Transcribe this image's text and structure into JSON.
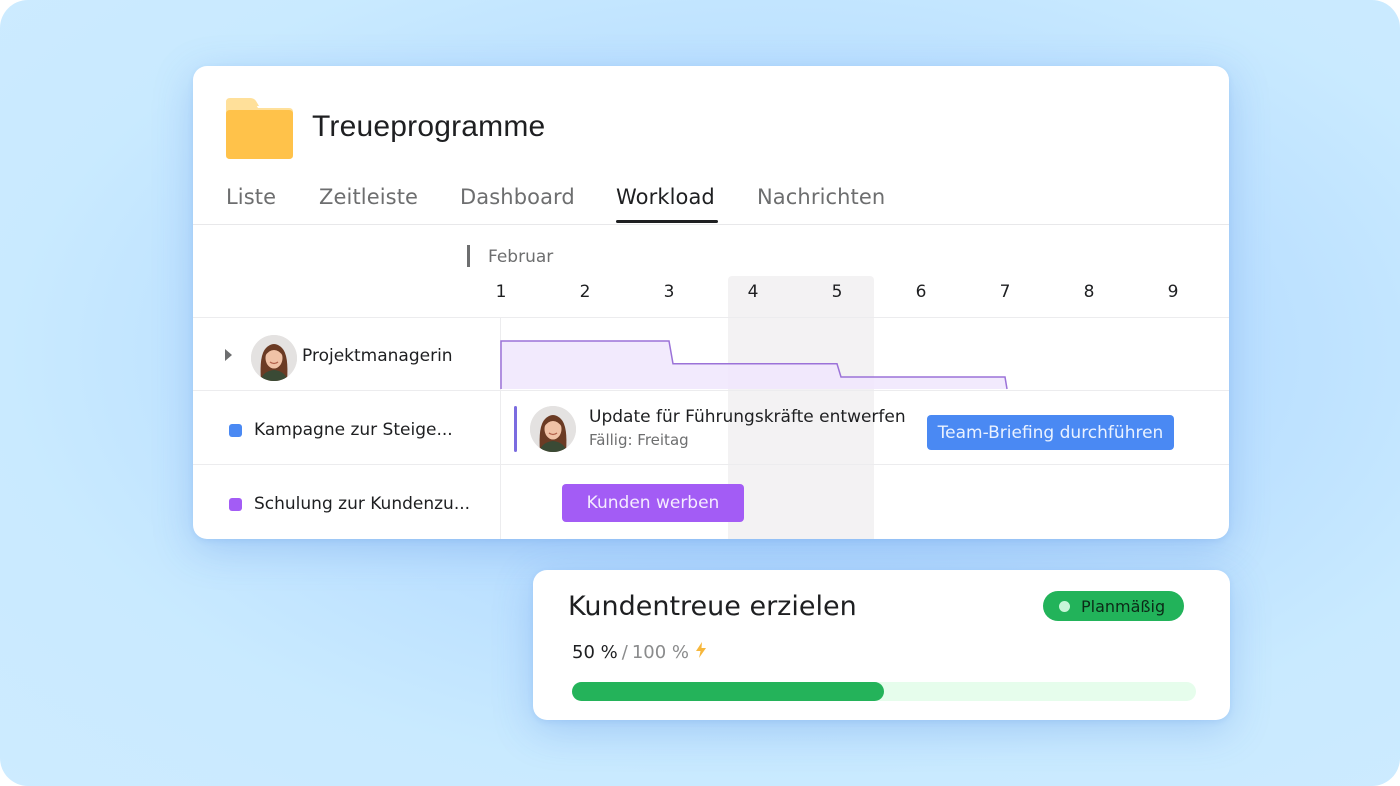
{
  "project": {
    "title": "Treueprogramme",
    "icon": "folder-icon",
    "folder_color": "#FFC24A"
  },
  "tabs": [
    {
      "label": "Liste",
      "active": false
    },
    {
      "label": "Zeitleiste",
      "active": false
    },
    {
      "label": "Dashboard",
      "active": false
    },
    {
      "label": "Workload",
      "active": true
    },
    {
      "label": "Nachrichten",
      "active": false
    }
  ],
  "timeline": {
    "month": "Februar",
    "days": [
      "1",
      "2",
      "3",
      "4",
      "5",
      "6",
      "7",
      "8",
      "9"
    ],
    "weekend_days": [
      "4",
      "5"
    ]
  },
  "rows": {
    "person": {
      "name": "Projektmanagerin",
      "expand_icon": "caret-right-icon",
      "workload_levels": [
        {
          "from_day": 1,
          "to_day": 3,
          "level": 0.8
        },
        {
          "from_day": 3,
          "to_day": 5,
          "level": 0.42
        },
        {
          "from_day": 5,
          "to_day": 7,
          "level": 0.2
        }
      ],
      "workload_color": "#9b72d8",
      "workload_fill": "#f0e6fd"
    },
    "projects": [
      {
        "name": "Kampagne zur Steige...",
        "color": "#4a89f3"
      },
      {
        "name": "Schulung zur Kundenzu...",
        "color": "#a35cf5"
      }
    ]
  },
  "tasks": {
    "update": {
      "title": "Update für Führungskräfte entwerfen",
      "due": "Fällig: Freitag"
    },
    "briefing": {
      "label": "Team-Briefing durchführen",
      "color": "#4a89f3"
    },
    "werben": {
      "label": "Kunden werben",
      "color": "#a35cf5"
    }
  },
  "goal": {
    "title": "Kundentreue erzielen",
    "status": "Planmäßig",
    "status_color": "#22b35a",
    "current": "50 %",
    "separator": "/",
    "target": "100 %",
    "progress": 0.5,
    "progress_color": "#24b35a",
    "bolt_icon": "lightning-icon"
  }
}
